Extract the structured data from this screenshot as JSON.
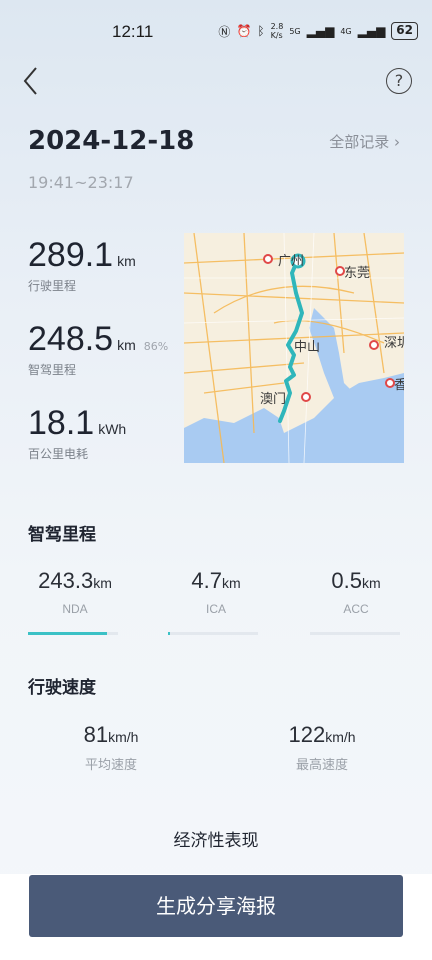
{
  "status_bar": {
    "time": "12:11",
    "net_speed_top": "2.8",
    "net_speed_bottom": "K/s",
    "signal1": "5G",
    "signal2": "4G",
    "battery": "62"
  },
  "nav": {
    "back_icon": "chevron-left-icon",
    "help_icon": "question-circle-icon",
    "help_glyph": "?"
  },
  "trip": {
    "date": "2024-12-18",
    "all_records_label": "全部记录 ›",
    "time_range": "19:41~23:17"
  },
  "stats": [
    {
      "value": "289.1",
      "unit": "km",
      "label": "行驶里程",
      "extra": ""
    },
    {
      "value": "248.5",
      "unit": "km",
      "label": "智驾里程",
      "extra": "86%"
    },
    {
      "value": "18.1",
      "unit": "kWh",
      "label": "百公里电耗",
      "extra": ""
    }
  ],
  "map": {
    "labels": [
      "广州",
      "东莞",
      "中山",
      "深圳",
      "澳门",
      "香"
    ]
  },
  "smart_drive": {
    "title": "智驾里程",
    "items": [
      {
        "value": "243.3",
        "unit": "km",
        "label": "NDA",
        "fraction": 0.88
      },
      {
        "value": "4.7",
        "unit": "km",
        "label": "ICA",
        "fraction": 0.02
      },
      {
        "value": "0.5",
        "unit": "km",
        "label": "ACC",
        "fraction": 0.0
      }
    ]
  },
  "speed": {
    "title": "行驶速度",
    "items": [
      {
        "value": "81",
        "unit": "km/h",
        "label": "平均速度"
      },
      {
        "value": "122",
        "unit": "km/h",
        "label": "最高速度"
      }
    ]
  },
  "economy_title": "经济性表现",
  "share_button": "生成分享海报",
  "colors": {
    "accent": "#3bc1c6",
    "button": "#4a5a78"
  }
}
